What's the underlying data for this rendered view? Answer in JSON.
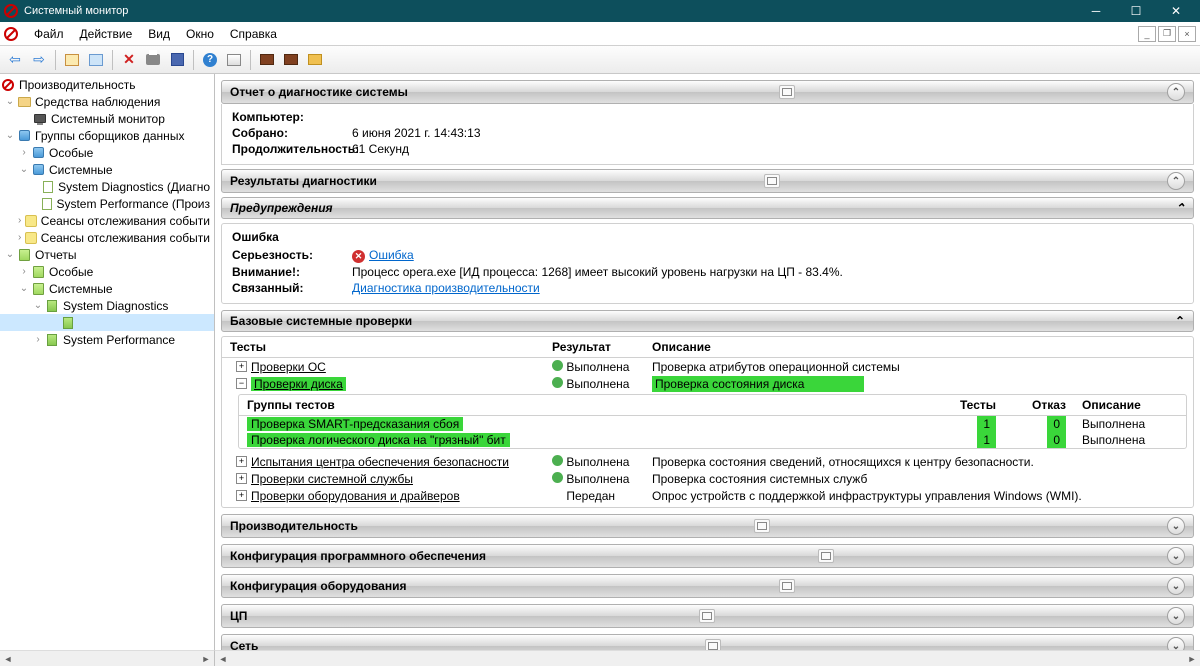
{
  "titlebar": {
    "title": "Системный монитор"
  },
  "menu": {
    "file": "Файл",
    "action": "Действие",
    "view": "Вид",
    "window": "Окно",
    "help": "Справка"
  },
  "tree": {
    "root": "Производительность",
    "monitoring_tools": "Средства наблюдения",
    "system_monitor": "Системный монитор",
    "collector_groups": "Группы сборщиков данных",
    "special": "Особые",
    "system": "Системные",
    "sys_diag": "System Diagnostics (Диагно",
    "sys_perf": "System Performance (Произ",
    "event_sessions1": "Сеансы отслеживания событи",
    "event_sessions2": "Сеансы отслеживания событи",
    "reports": "Отчеты",
    "r_special": "Особые",
    "r_system": "Системные",
    "r_sys_diag": "System Diagnostics",
    "r_sys_perf": "System Performance"
  },
  "report": {
    "title": "Отчет о диагностике системы",
    "computer_k": "Компьютер:",
    "computer_v": "",
    "collected_k": "Собрано:",
    "collected_v": "6 июня 2021 г. 14:43:13",
    "duration_k": "Продолжительность:",
    "duration_v": "61 Секунд"
  },
  "diag_results": "Результаты диагностики",
  "warnings": "Предупреждения",
  "error": {
    "title": "Ошибка",
    "severity_k": "Серьезность:",
    "severity_v": "Ошибка",
    "attention_k": "Внимание!:",
    "attention_v": "Процесс opera.exe [ИД процесса: 1268] имеет высокий уровень нагрузки на ЦП - 83.4%.",
    "related_k": "Связанный:",
    "related_v": "Диагностика производительности"
  },
  "base_checks": {
    "title": "Базовые системные проверки",
    "h_tests": "Тесты",
    "h_result": "Результат",
    "h_desc": "Описание",
    "rows": [
      {
        "name": "Проверки ОС",
        "result": "Выполнена",
        "desc": "Проверка атрибутов операционной системы"
      },
      {
        "name": "Проверки диска",
        "result": "Выполнена",
        "desc": "Проверка состояния диска"
      },
      {
        "name": "Испытания центра обеспечения безопасности",
        "result": "Выполнена",
        "desc": "Проверка состояния сведений, относящихся к центру безопасности."
      },
      {
        "name": "Проверки системной службы",
        "result": "Выполнена",
        "desc": "Проверка состояния системных служб"
      },
      {
        "name": "Проверки оборудования и драйверов",
        "result": "Передан",
        "desc": "Опрос устройств с поддержкой инфраструктуры управления Windows (WMI)."
      }
    ],
    "sub": {
      "h_groups": "Группы тестов",
      "h_tests": "Тесты",
      "h_fail": "Отказ",
      "h_desc": "Описание",
      "rows": [
        {
          "name": "Проверка SMART-предсказания сбоя",
          "tests": "1",
          "fail": "0",
          "desc": "Выполнена"
        },
        {
          "name": "Проверка логического диска на \"грязный\" бит",
          "tests": "1",
          "fail": "0",
          "desc": "Выполнена"
        }
      ]
    }
  },
  "sections": {
    "performance": "Производительность",
    "sw_config": "Конфигурация программного обеспечения",
    "hw_config": "Конфигурация оборудования",
    "cpu": "ЦП",
    "net": "Сеть"
  }
}
